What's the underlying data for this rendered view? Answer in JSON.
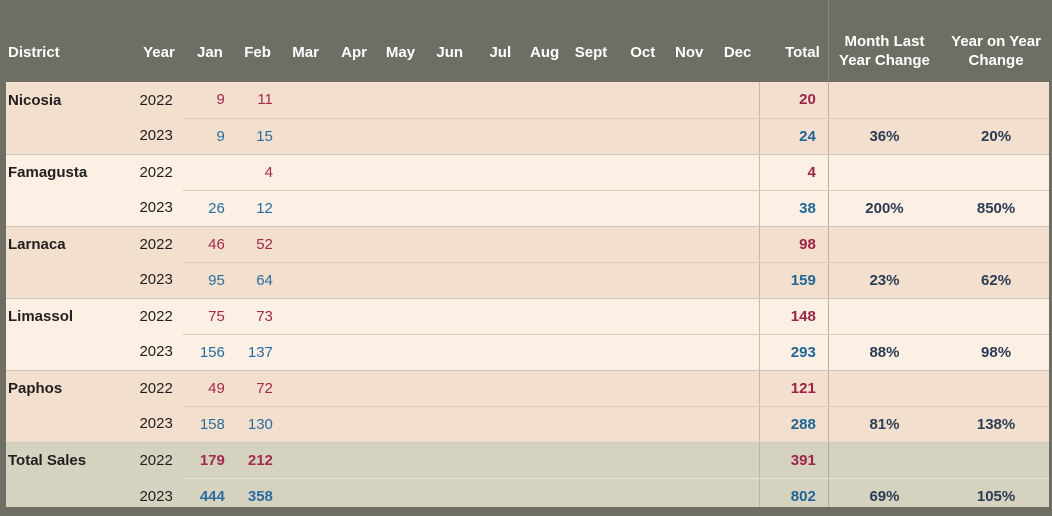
{
  "table": {
    "columns": {
      "district": "District",
      "year": "Year",
      "months": [
        "Jan",
        "Feb",
        "Mar",
        "Apr",
        "May",
        "Jun",
        "Jul",
        "Aug",
        "Sept",
        "Oct",
        "Nov",
        "Dec"
      ],
      "total": "Total",
      "month_last_year_change": "Month Last Year Change",
      "year_on_year_change": "Year on Year Change"
    },
    "colors": {
      "header_background": "#6e6e65",
      "header_text": "#ffffff",
      "row_shade_dark": "#f2dfcd",
      "row_shade_light": "#fcefe3",
      "total_band": "#d5d2c0",
      "value_2022": "#a32a4e",
      "value_2023": "#2a6d9e",
      "change_text": "#2c3c55"
    },
    "rows": [
      {
        "district": "Nicosia",
        "year": "2022",
        "months": [
          "9",
          "11",
          "",
          "",
          "",
          "",
          "",
          "",
          "",
          "",
          "",
          ""
        ],
        "total": "20",
        "month_last_year_change": "",
        "year_on_year_change": ""
      },
      {
        "district": "",
        "year": "2023",
        "months": [
          "9",
          "15",
          "",
          "",
          "",
          "",
          "",
          "",
          "",
          "",
          "",
          ""
        ],
        "total": "24",
        "month_last_year_change": "36%",
        "year_on_year_change": "20%"
      },
      {
        "district": "Famagusta",
        "year": "2022",
        "months": [
          "",
          "4",
          "",
          "",
          "",
          "",
          "",
          "",
          "",
          "",
          "",
          ""
        ],
        "total": "4",
        "month_last_year_change": "",
        "year_on_year_change": ""
      },
      {
        "district": "",
        "year": "2023",
        "months": [
          "26",
          "12",
          "",
          "",
          "",
          "",
          "",
          "",
          "",
          "",
          "",
          ""
        ],
        "total": "38",
        "month_last_year_change": "200%",
        "year_on_year_change": "850%"
      },
      {
        "district": "Larnaca",
        "year": "2022",
        "months": [
          "46",
          "52",
          "",
          "",
          "",
          "",
          "",
          "",
          "",
          "",
          "",
          ""
        ],
        "total": "98",
        "month_last_year_change": "",
        "year_on_year_change": ""
      },
      {
        "district": "",
        "year": "2023",
        "months": [
          "95",
          "64",
          "",
          "",
          "",
          "",
          "",
          "",
          "",
          "",
          "",
          ""
        ],
        "total": "159",
        "month_last_year_change": "23%",
        "year_on_year_change": "62%"
      },
      {
        "district": "Limassol",
        "year": "2022",
        "months": [
          "75",
          "73",
          "",
          "",
          "",
          "",
          "",
          "",
          "",
          "",
          "",
          ""
        ],
        "total": "148",
        "month_last_year_change": "",
        "year_on_year_change": ""
      },
      {
        "district": "",
        "year": "2023",
        "months": [
          "156",
          "137",
          "",
          "",
          "",
          "",
          "",
          "",
          "",
          "",
          "",
          ""
        ],
        "total": "293",
        "month_last_year_change": "88%",
        "year_on_year_change": "98%"
      },
      {
        "district": "Paphos",
        "year": "2022",
        "months": [
          "49",
          "72",
          "",
          "",
          "",
          "",
          "",
          "",
          "",
          "",
          "",
          ""
        ],
        "total": "121",
        "month_last_year_change": "",
        "year_on_year_change": ""
      },
      {
        "district": "",
        "year": "2023",
        "months": [
          "158",
          "130",
          "",
          "",
          "",
          "",
          "",
          "",
          "",
          "",
          "",
          ""
        ],
        "total": "288",
        "month_last_year_change": "81%",
        "year_on_year_change": "138%"
      },
      {
        "district": "Total Sales",
        "year": "2022",
        "months": [
          "179",
          "212",
          "",
          "",
          "",
          "",
          "",
          "",
          "",
          "",
          "",
          ""
        ],
        "total": "391",
        "month_last_year_change": "",
        "year_on_year_change": ""
      },
      {
        "district": "",
        "year": "2023",
        "months": [
          "444",
          "358",
          "",
          "",
          "",
          "",
          "",
          "",
          "",
          "",
          "",
          ""
        ],
        "total": "802",
        "month_last_year_change": "69%",
        "year_on_year_change": "105%"
      }
    ]
  }
}
